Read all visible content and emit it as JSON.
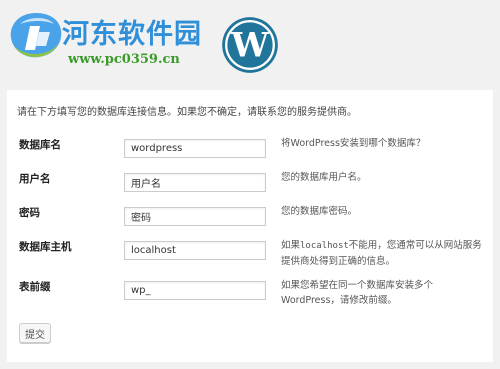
{
  "watermark": {
    "title": "河东软件园",
    "url": "www.pc0359.cn"
  },
  "form": {
    "intro": "请在下方填写您的数据库连接信息。如果您不确定，请联系您的服务提供商。",
    "fields": [
      {
        "label": "数据库名",
        "value": "wordpress",
        "hint": "将WordPress安装到哪个数据库？"
      },
      {
        "label": "用户名",
        "value": "用户名",
        "hint": "您的数据库用户名。"
      },
      {
        "label": "密码",
        "value": "密码",
        "hint": "您的数据库密码。"
      },
      {
        "label": "数据库主机",
        "value": "localhost",
        "hint_pre": "如果",
        "hint_code": "localhost",
        "hint_post": "不能用，您通常可以从网站服务提供商处得到正确的信息。"
      },
      {
        "label": "表前缀",
        "value": "wp_",
        "hint": "如果您希望在同一个数据库安装多个WordPress，请修改前缀。"
      }
    ],
    "submit_label": "提交"
  },
  "colors": {
    "background": "#f1f1f1",
    "card": "#ffffff",
    "wp_logo": "#21759b",
    "watermark_title": "#2f8fd8",
    "watermark_url": "#3a9a2a"
  }
}
